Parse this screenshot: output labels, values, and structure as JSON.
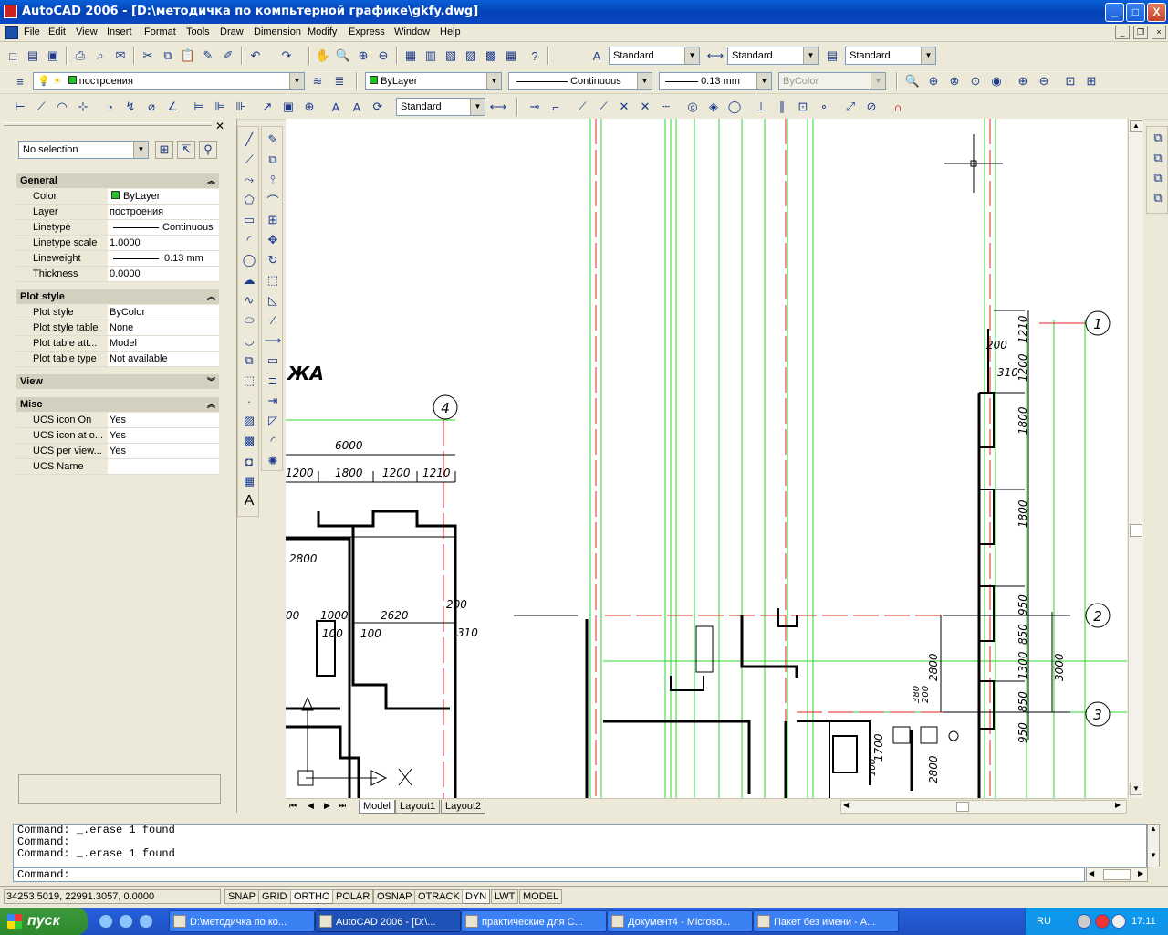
{
  "window": {
    "title": "AutoCAD 2006 - [D:\\методичка по компьтерной графике\\gkfy.dwg]",
    "buttons": [
      "_",
      "□",
      "X"
    ]
  },
  "menu": [
    "File",
    "Edit",
    "View",
    "Insert",
    "Format",
    "Tools",
    "Draw",
    "Dimension",
    "Modify",
    "Express",
    "Window",
    "Help"
  ],
  "styles_toolbar": {
    "text_style": "Standard",
    "dim_style": "Standard",
    "table_style": "Standard"
  },
  "layers_toolbar": {
    "layer": "построения",
    "color": "ByLayer",
    "linetype": "Continuous",
    "lineweight": "0.13 mm",
    "plotstyle": "ByColor"
  },
  "dim_toolbar": {
    "dim_style": "Standard"
  },
  "properties": {
    "selection": "No selection",
    "general": {
      "title": "General",
      "rows": [
        {
          "k": "Color",
          "v": "ByLayer"
        },
        {
          "k": "Layer",
          "v": "построения"
        },
        {
          "k": "Linetype",
          "v": "Continuous"
        },
        {
          "k": "Linetype scale",
          "v": "1.0000"
        },
        {
          "k": "Lineweight",
          "v": "0.13 mm"
        },
        {
          "k": "Thickness",
          "v": "0.0000"
        }
      ]
    },
    "plot": {
      "title": "Plot style",
      "rows": [
        {
          "k": "Plot style",
          "v": "ByColor"
        },
        {
          "k": "Plot style table",
          "v": "None"
        },
        {
          "k": "Plot table att...",
          "v": "Model"
        },
        {
          "k": "Plot table type",
          "v": "Not available"
        }
      ]
    },
    "view": {
      "title": "View"
    },
    "misc": {
      "title": "Misc",
      "rows": [
        {
          "k": "UCS icon On",
          "v": "Yes"
        },
        {
          "k": "UCS icon at o...",
          "v": "Yes"
        },
        {
          "k": "UCS per view...",
          "v": "Yes"
        },
        {
          "k": "UCS Name",
          "v": ""
        }
      ]
    }
  },
  "drawing": {
    "labels": {
      "zha": "ЖА",
      "axis_1": "1",
      "axis_2": "2",
      "axis_3": "3",
      "axis_4": "4"
    },
    "dims": {
      "d6000": "6000",
      "d1200a": "1200",
      "d1800a": "1800",
      "d1200b": "1200",
      "d1210a": "1210",
      "d2800a": "2800",
      "d00": "00",
      "d1000": "1000",
      "d2620": "2620",
      "d200a": "200",
      "d310a": "310",
      "d100a": "100",
      "d100b": "100",
      "r1210": "1210",
      "r200": "200",
      "r310": "310",
      "r1200": "1200",
      "r1800a": "1800",
      "r1800b": "1800",
      "r950a": "950",
      "r850a": "850",
      "r1300": "1300",
      "r850b": "850",
      "r950b": "950",
      "r2800a": "2800",
      "r3000": "3000",
      "r2800b": "2800",
      "r1700": "1700",
      "r200b": "200",
      "r100": "100",
      "r380": "380"
    }
  },
  "tabs": [
    "Model",
    "Layout1",
    "Layout2"
  ],
  "command_history": [
    "Command: _.erase 1 found",
    "Command:",
    "Command: _.erase 1 found"
  ],
  "command_prompt": "Command:",
  "status": {
    "coords": "34253.5019, 22991.3057, 0.0000",
    "buttons": [
      "SNAP",
      "GRID",
      "ORTHO",
      "POLAR",
      "OSNAP",
      "OTRACK",
      "DYN",
      "LWT",
      "MODEL"
    ]
  },
  "taskbar": {
    "start": "пуск",
    "tasks": [
      "D:\\методичка по ко...",
      "AutoCAD 2006 - [D:\\...",
      "практические для С...",
      "Документ4 - Microso...",
      "Пакет без имени - А..."
    ],
    "lang": "RU",
    "clock": "17:11"
  }
}
